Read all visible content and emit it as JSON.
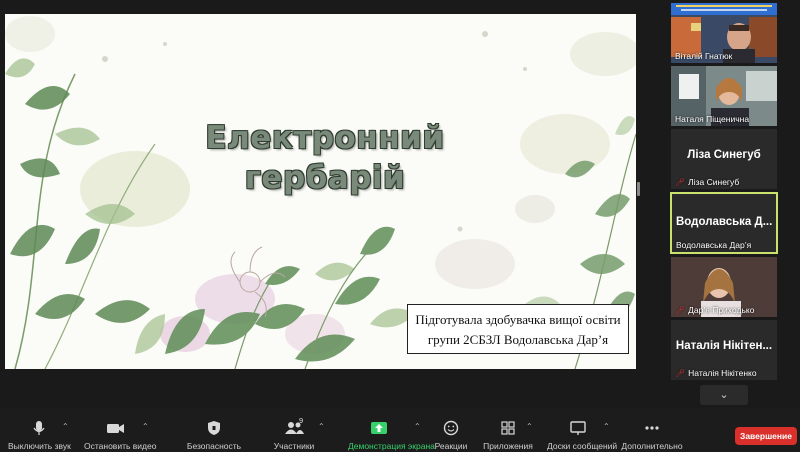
{
  "slide": {
    "title_line1": "Електронний",
    "title_line2": "гербарій",
    "author_line1": "Підготувала здобувачка вищої освіти",
    "author_line2": "групи 2СБЗЛ Водолавська Дар’я"
  },
  "participants": [
    {
      "name": "Віталій Гнатюк",
      "muted": false,
      "video": true
    },
    {
      "name": "Наталя Піщенична",
      "muted": false,
      "video": true
    },
    {
      "name": "Ліза Синегуб",
      "display": "Ліза Синегуб",
      "muted": true,
      "video": false
    },
    {
      "name": "Водолавська Дар’я",
      "display": "Водолавська  Д...",
      "muted": false,
      "video": false,
      "active": true
    },
    {
      "name": "Дар’я Приходько",
      "muted": true,
      "video": true
    },
    {
      "name": "Наталія Нікітенко",
      "display": "Наталія Нікітен...",
      "muted": true,
      "video": false
    }
  ],
  "toolbar": {
    "mute": "Выключить звук",
    "video": "Остановить видео",
    "security": "Безопасность",
    "participants": "Участники",
    "participants_count": "9",
    "share": "Демонстрация экрана",
    "reactions": "Реакции",
    "apps": "Приложения",
    "whiteboards": "Доски сообщений",
    "more": "Дополнительно",
    "end": "Завершение"
  },
  "colors": {
    "accent_green": "#37d16b",
    "active_border": "#c8e26b",
    "end_red": "#d9302c",
    "muted_red": "#e03b3b"
  }
}
